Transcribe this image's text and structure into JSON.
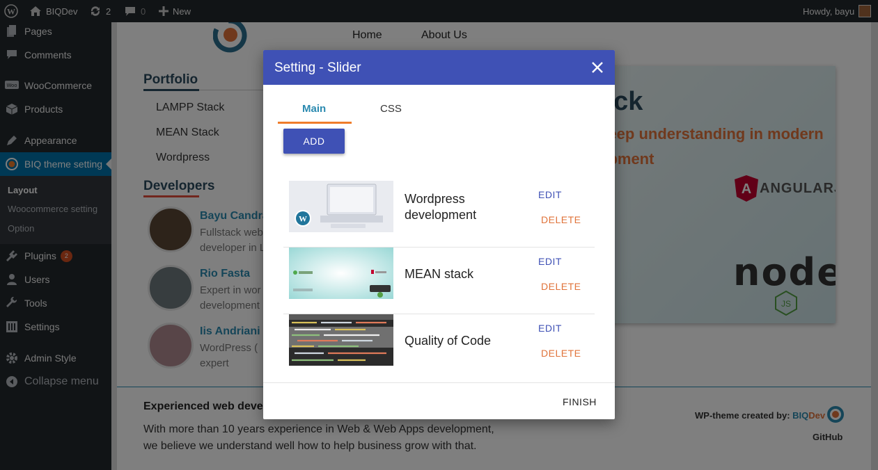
{
  "admin_bar": {
    "site_name": "BIQDev",
    "updates_count": "2",
    "comments_count": "0",
    "new_label": "New",
    "greeting": "Howdy, bayu"
  },
  "sidebar": {
    "items": [
      {
        "label": "Pages",
        "icon": "pages-icon"
      },
      {
        "label": "Comments",
        "icon": "comments-icon"
      },
      {
        "label": "WooCommerce",
        "icon": "woocommerce-icon"
      },
      {
        "label": "Products",
        "icon": "products-icon"
      },
      {
        "label": "Appearance",
        "icon": "appearance-icon"
      },
      {
        "label": "BIQ theme setting",
        "icon": "biq-icon"
      },
      {
        "label": "Plugins",
        "icon": "plugins-icon"
      },
      {
        "label": "Users",
        "icon": "users-icon"
      },
      {
        "label": "Tools",
        "icon": "tools-icon"
      },
      {
        "label": "Settings",
        "icon": "settings-icon"
      },
      {
        "label": "Admin Style",
        "icon": "admin-style-icon"
      },
      {
        "label": "Collapse menu",
        "icon": "collapse-icon"
      }
    ],
    "plugins_badge": "2",
    "submenu": [
      "Layout",
      "Woocommerce setting",
      "Option"
    ]
  },
  "site": {
    "nav": [
      "Home",
      "About Us"
    ],
    "portfolio_title": "Portfolio",
    "portfolio_items": [
      "LAMPP Stack",
      "MEAN Stack",
      "Wordpress"
    ],
    "developers_title": "Developers",
    "developers": [
      {
        "name": "Bayu Candra",
        "desc1": "Fullstack web",
        "desc2": "developer in L"
      },
      {
        "name": "Rio Fasta",
        "desc1": "Expert in wor",
        "desc2": "development"
      },
      {
        "name": "Iis Andriani",
        "desc1": "WordPress ( ",
        "desc2": "expert"
      }
    ],
    "hero_title": "ack",
    "hero_sub1": "deep understanding in modern",
    "hero_sub2": "opment",
    "hero_angular": "ANGULARJS",
    "hero_node": "node",
    "footer_title": "Experienced web develo",
    "footer_line1": "With more than 10 years experience in Web & Web Apps development,",
    "footer_line2": "we believe we understand well how to help business grow with that.",
    "credit_prefix": "WP-theme created by: ",
    "credit_biq": "BIQ",
    "credit_dev": "Dev",
    "github": "GitHub"
  },
  "modal": {
    "title": "Setting - Slider",
    "tabs": [
      "Main",
      "CSS"
    ],
    "active_tab": "Main",
    "add_label": "ADD",
    "slides": [
      {
        "title": "Wordpress development",
        "title_line1": "Wordpress",
        "title_line2": "development"
      },
      {
        "title": "MEAN stack",
        "title_line1": "MEAN stack",
        "title_line2": ""
      },
      {
        "title": "Quality of Code",
        "title_line1": "Quality of Code",
        "title_line2": ""
      }
    ],
    "edit_label": "EDIT",
    "delete_label": "DELETE",
    "finish_label": "FINISH"
  },
  "colors": {
    "admin_bg": "#23282d",
    "active_menu": "#0073aa",
    "modal_header": "#3f51b5",
    "tab_indicator": "#ef7c2a",
    "delete": "#e0733a",
    "accent_teal": "#2b8ab0"
  }
}
